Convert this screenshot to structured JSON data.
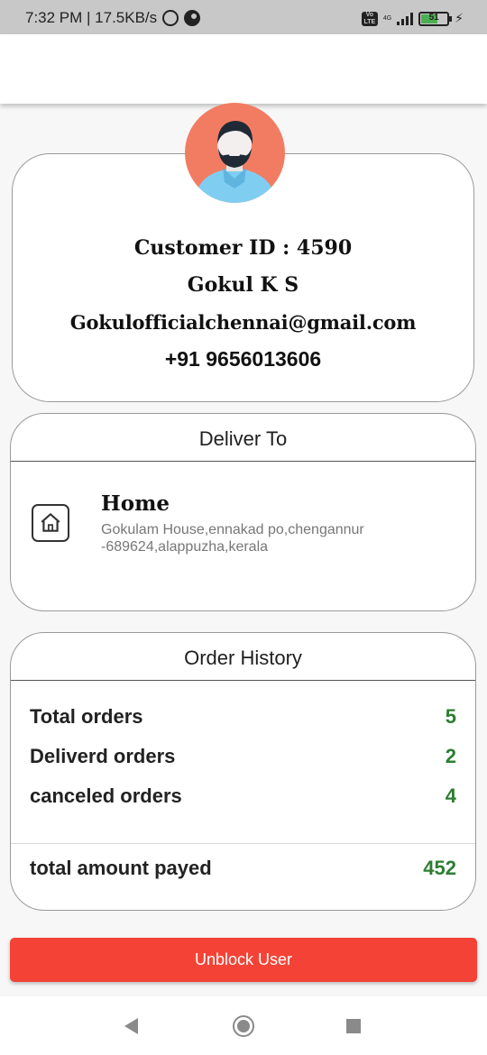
{
  "status_bar": {
    "time_speed": "7:32 PM | 17.5KB/s",
    "network_type": "4G",
    "volte_label": "Vo LTE",
    "battery_level": "51"
  },
  "profile": {
    "customer_id": "Customer ID : 4590",
    "name": "Gokul K S",
    "email": "Gokulofficialchennai@gmail.com",
    "phone": "+91 9656013606"
  },
  "deliver": {
    "header": "Deliver To",
    "address_type": "Home",
    "address": "Gokulam House,ennakad po,chengannur -689624,alappuzha,kerala"
  },
  "order_history": {
    "header": "Order History",
    "rows": [
      {
        "label": "Total orders",
        "value": "5"
      },
      {
        "label": "Deliverd orders",
        "value": "2"
      },
      {
        "label": "canceled orders",
        "value": "4"
      }
    ],
    "total_label": "total amount payed",
    "total_value": "452"
  },
  "actions": {
    "unblock_label": "Unblock User"
  },
  "colors": {
    "accent_red": "#f44336",
    "value_green": "#2e7d32",
    "avatar_bg": "#f27c62"
  },
  "icons": [
    "alarm-icon",
    "data-saver-icon",
    "signal-icon",
    "battery-icon",
    "charging-icon",
    "home-icon",
    "back-icon",
    "home-nav-icon",
    "recents-icon"
  ]
}
